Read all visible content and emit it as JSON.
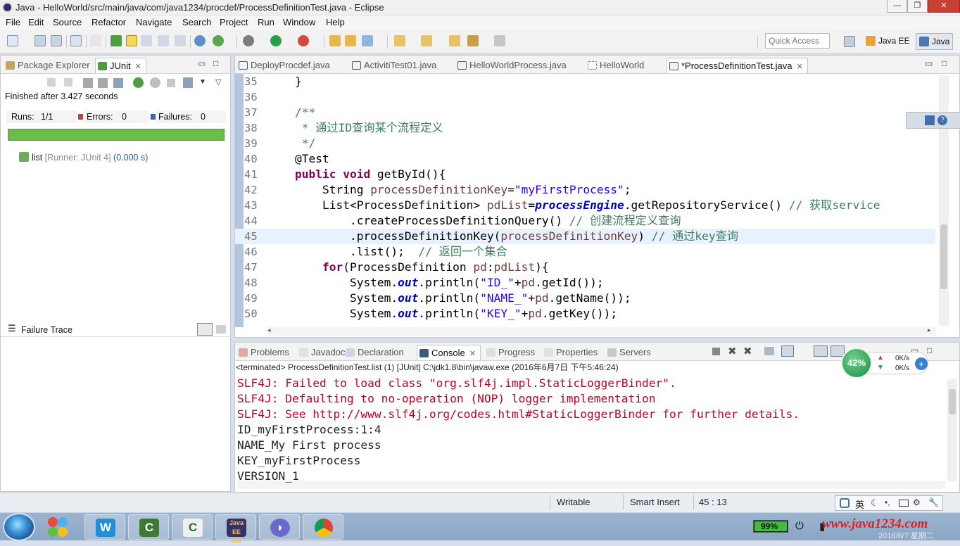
{
  "window": {
    "title": "Java - HelloWorld/src/main/java/com/java1234/procdef/ProcessDefinitionTest.java - Eclipse",
    "controls": {
      "minimize": "—",
      "maximize": "❐",
      "close": "✕"
    }
  },
  "menubar": [
    "File",
    "Edit",
    "Source",
    "Refactor",
    "Navigate",
    "Search",
    "Project",
    "Run",
    "Window",
    "Help"
  ],
  "toolbar": {
    "quick_access_placeholder": "Quick Access",
    "perspectives": [
      "Java EE",
      "Java"
    ]
  },
  "left_pane": {
    "tabs": [
      {
        "label": "Package Explorer",
        "icon": "package-explorer-icon"
      },
      {
        "label": "JUnit",
        "icon": "junit-icon",
        "active": true
      }
    ],
    "status": "Finished after 3.427 seconds",
    "runs_label": "Runs:",
    "runs_value": "1/1",
    "errors_label": "Errors:",
    "errors_value": "0",
    "failures_label": "Failures:",
    "failures_value": "0",
    "tree_item": {
      "name": "list",
      "detail": "[Runner: JUnit 4]",
      "time": "(0.000 s)"
    },
    "failure_trace_label": "Failure Trace",
    "bar_color": "#69be4a"
  },
  "editor": {
    "tabs": [
      {
        "label": "DeployProcdef.java"
      },
      {
        "label": "ActivitiTest01.java"
      },
      {
        "label": "HelloWorldProcess.java"
      },
      {
        "label": "HelloWorld"
      },
      {
        "label": "*ProcessDefinitionTest.java",
        "active": true
      }
    ],
    "highlighted_line": 45,
    "lines": [
      {
        "num": "35",
        "segs": [
          [
            "",
            "    }"
          ]
        ]
      },
      {
        "num": "36",
        "segs": [
          [
            "",
            ""
          ]
        ]
      },
      {
        "num": "37",
        "segs": [
          [
            "cm",
            "    /**"
          ]
        ]
      },
      {
        "num": "38",
        "segs": [
          [
            "cm",
            "     * 通过ID查询某个流程定义"
          ]
        ]
      },
      {
        "num": "39",
        "segs": [
          [
            "cm",
            "     */"
          ]
        ]
      },
      {
        "num": "40",
        "segs": [
          [
            "",
            "    @Test"
          ]
        ]
      },
      {
        "num": "41",
        "segs": [
          [
            "kw",
            "    public void"
          ],
          [
            "",
            " getById(){"
          ]
        ]
      },
      {
        "num": "42",
        "segs": [
          [
            "",
            "        String "
          ],
          [
            "vr",
            "processDefinitionKey"
          ],
          [
            "",
            "="
          ],
          [
            "st",
            "\"myFirstProcess\""
          ],
          [
            "",
            ";"
          ]
        ]
      },
      {
        "num": "43",
        "segs": [
          [
            "",
            "        List<ProcessDefinition> "
          ],
          [
            "vr",
            "pdList"
          ],
          [
            "",
            "="
          ],
          [
            "fd",
            "processEngine"
          ],
          [
            "",
            ".getRepositoryService() "
          ],
          [
            "cm",
            "// 获取service"
          ]
        ]
      },
      {
        "num": "44",
        "segs": [
          [
            "",
            "            .createProcessDefinitionQuery() "
          ],
          [
            "cm",
            "// 创建流程定义查询"
          ]
        ]
      },
      {
        "num": "45",
        "segs": [
          [
            "",
            "            .processDefinitionKey("
          ],
          [
            "vr",
            "processDefinitionKey"
          ],
          [
            "",
            ") "
          ],
          [
            "cm",
            "// 通过key查询"
          ]
        ]
      },
      {
        "num": "46",
        "segs": [
          [
            "",
            "            .list();  "
          ],
          [
            "cm",
            "// 返回一个集合"
          ]
        ]
      },
      {
        "num": "47",
        "segs": [
          [
            "kw",
            "        for"
          ],
          [
            "",
            "(ProcessDefinition "
          ],
          [
            "vr",
            "pd"
          ],
          [
            "",
            ":"
          ],
          [
            "vr",
            "pdList"
          ],
          [
            "",
            "){"
          ]
        ]
      },
      {
        "num": "48",
        "segs": [
          [
            "",
            "            System."
          ],
          [
            "fd",
            "out"
          ],
          [
            "",
            ".println("
          ],
          [
            "st",
            "\"ID_\""
          ],
          [
            "",
            "+"
          ],
          [
            "vr",
            "pd"
          ],
          [
            "",
            ".getId());"
          ]
        ]
      },
      {
        "num": "49",
        "segs": [
          [
            "",
            "            System."
          ],
          [
            "fd",
            "out"
          ],
          [
            "",
            ".println("
          ],
          [
            "st",
            "\"NAME_\""
          ],
          [
            "",
            "+"
          ],
          [
            "vr",
            "pd"
          ],
          [
            "",
            ".getName());"
          ]
        ]
      },
      {
        "num": "50",
        "segs": [
          [
            "",
            "            System."
          ],
          [
            "fd",
            "out"
          ],
          [
            "",
            ".println("
          ],
          [
            "st",
            "\"KEY_\""
          ],
          [
            "",
            "+"
          ],
          [
            "vr",
            "pd"
          ],
          [
            "",
            ".getKey());"
          ]
        ]
      }
    ]
  },
  "bottom_pane": {
    "tabs": [
      {
        "label": "Problems"
      },
      {
        "label": "Javadoc"
      },
      {
        "label": "Declaration"
      },
      {
        "label": "Console",
        "active": true
      },
      {
        "label": "Progress"
      },
      {
        "label": "Properties"
      },
      {
        "label": "Servers"
      }
    ],
    "console_header": "<terminated> ProcessDefinitionTest.list (1) [JUnit] C:\\jdk1.8\\bin\\javaw.exe (2016年6月7日 下午5:46:24)",
    "output": [
      {
        "text": "SLF4J: Failed to load class \"org.slf4j.impl.StaticLoggerBinder\".",
        "err": true
      },
      {
        "text": "SLF4J: Defaulting to no-operation (NOP) logger implementation",
        "err": true
      },
      {
        "text": "SLF4J: See http://www.slf4j.org/codes.html#StaticLoggerBinder for further details.",
        "err": true
      },
      {
        "text": "ID_myFirstProcess:1:4",
        "err": false
      },
      {
        "text": "NAME_My First process",
        "err": false
      },
      {
        "text": "KEY_myFirstProcess",
        "err": false
      },
      {
        "text": "VERSION_1",
        "err": false
      }
    ]
  },
  "net_widget": {
    "percent": "42%",
    "up": "0K/s",
    "down": "0K/s"
  },
  "statusbar": {
    "mode": "Writable",
    "insert": "Smart Insert",
    "position": "45 : 13",
    "ime": "英"
  },
  "taskbar": {
    "apps": [
      "Windows Live Writer",
      "Camtasia Recorder",
      "Camtasia Studio",
      "Java EE IDE",
      "Player",
      "Google Chrome"
    ],
    "battery": "99%",
    "watermark": "www.java1234.com",
    "date": "2016/6/7 星期二"
  }
}
